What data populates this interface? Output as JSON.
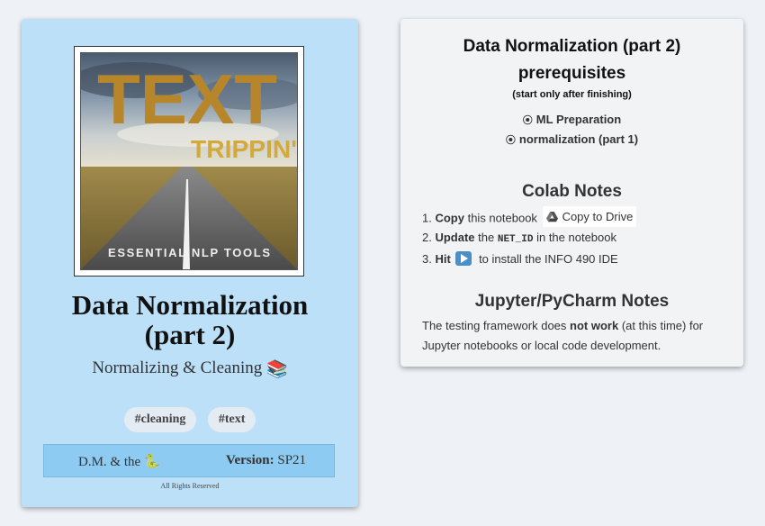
{
  "cover": {
    "big_word": "TEXT",
    "script_word": "TRIPPIN'",
    "bottom_caption": "ESSENTIAL NLP TOOLS"
  },
  "book": {
    "title_line1": "Data Normalization",
    "title_line2": "(part 2)",
    "subtitle": "Normalizing & Cleaning",
    "subtitle_emoji": "📚",
    "tags": [
      "#cleaning",
      "#text"
    ],
    "author": "D.M. & the",
    "author_emoji": "🐍",
    "version_label": "Version:",
    "version_value": "SP21",
    "rights": "All Rights Reserved"
  },
  "panel": {
    "title": "Data Normalization (part 2)",
    "prereq_heading": "prerequisites",
    "prereq_note": "(start only after finishing)",
    "prereq_items": [
      "ML Preparation",
      "normalization (part 1)"
    ],
    "radio_glyph": "⦿",
    "colab_heading": "Colab Notes",
    "steps": [
      {
        "num": "1.",
        "bold": "Copy",
        "rest": "this notebook",
        "button": "Copy to Drive"
      },
      {
        "num": "2.",
        "bold": "Update",
        "mid": "the",
        "code": "NET_ID",
        "rest": "in the notebook"
      },
      {
        "num": "3.",
        "bold": "Hit",
        "rest": "to install the INFO 490 IDE"
      }
    ],
    "jupyter_heading": "Jupyter/PyCharm Notes",
    "notes_pre": "The testing framework does",
    "notes_bold": "not work",
    "notes_post": "(at this time) for Jupyter notebooks or local code development."
  },
  "icons": {
    "drive": "google-drive-icon",
    "play": "play-button-icon",
    "radio": "radio-bullet-icon"
  },
  "colors": {
    "card_bg": "#bde0f9",
    "footer_bg": "#8ecbf2",
    "page_bg": "#eef2f7",
    "panel_bg": "#f2f3f5",
    "cover_gold": "#b8862a"
  }
}
